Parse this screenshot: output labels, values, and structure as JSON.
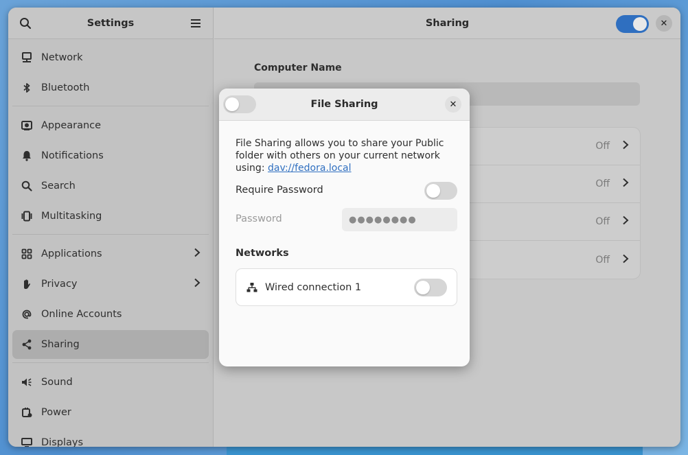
{
  "sidebar": {
    "title": "Settings",
    "items": [
      {
        "label": "Network",
        "icon": "network-icon"
      },
      {
        "label": "Bluetooth",
        "icon": "bluetooth-icon"
      },
      {
        "label": "Appearance",
        "icon": "appearance-icon"
      },
      {
        "label": "Notifications",
        "icon": "bell-icon"
      },
      {
        "label": "Search",
        "icon": "search-icon"
      },
      {
        "label": "Multitasking",
        "icon": "multitasking-icon"
      },
      {
        "label": "Applications",
        "icon": "grid-icon"
      },
      {
        "label": "Privacy",
        "icon": "hand-icon"
      },
      {
        "label": "Online Accounts",
        "icon": "at-icon"
      },
      {
        "label": "Sharing",
        "icon": "share-icon"
      },
      {
        "label": "Sound",
        "icon": "speaker-icon"
      },
      {
        "label": "Power",
        "icon": "power-icon"
      },
      {
        "label": "Displays",
        "icon": "display-icon"
      }
    ]
  },
  "main": {
    "title": "Sharing",
    "computer_name_label": "Computer Name",
    "rows": [
      {
        "status": "Off"
      },
      {
        "status": "Off"
      },
      {
        "status": "Off"
      },
      {
        "status": "Off"
      }
    ]
  },
  "dialog": {
    "title": "File Sharing",
    "description": "File Sharing allows you to share your Public folder with others on your current network using: ",
    "link": "dav://fedora.local",
    "require_password_label": "Require Password",
    "password_label": "Password",
    "password_value": "●●●●●●●●",
    "networks_label": "Networks",
    "network_name": "Wired connection 1"
  },
  "colors": {
    "accent": "#2f6fc0",
    "link": "#2f6fc0"
  }
}
